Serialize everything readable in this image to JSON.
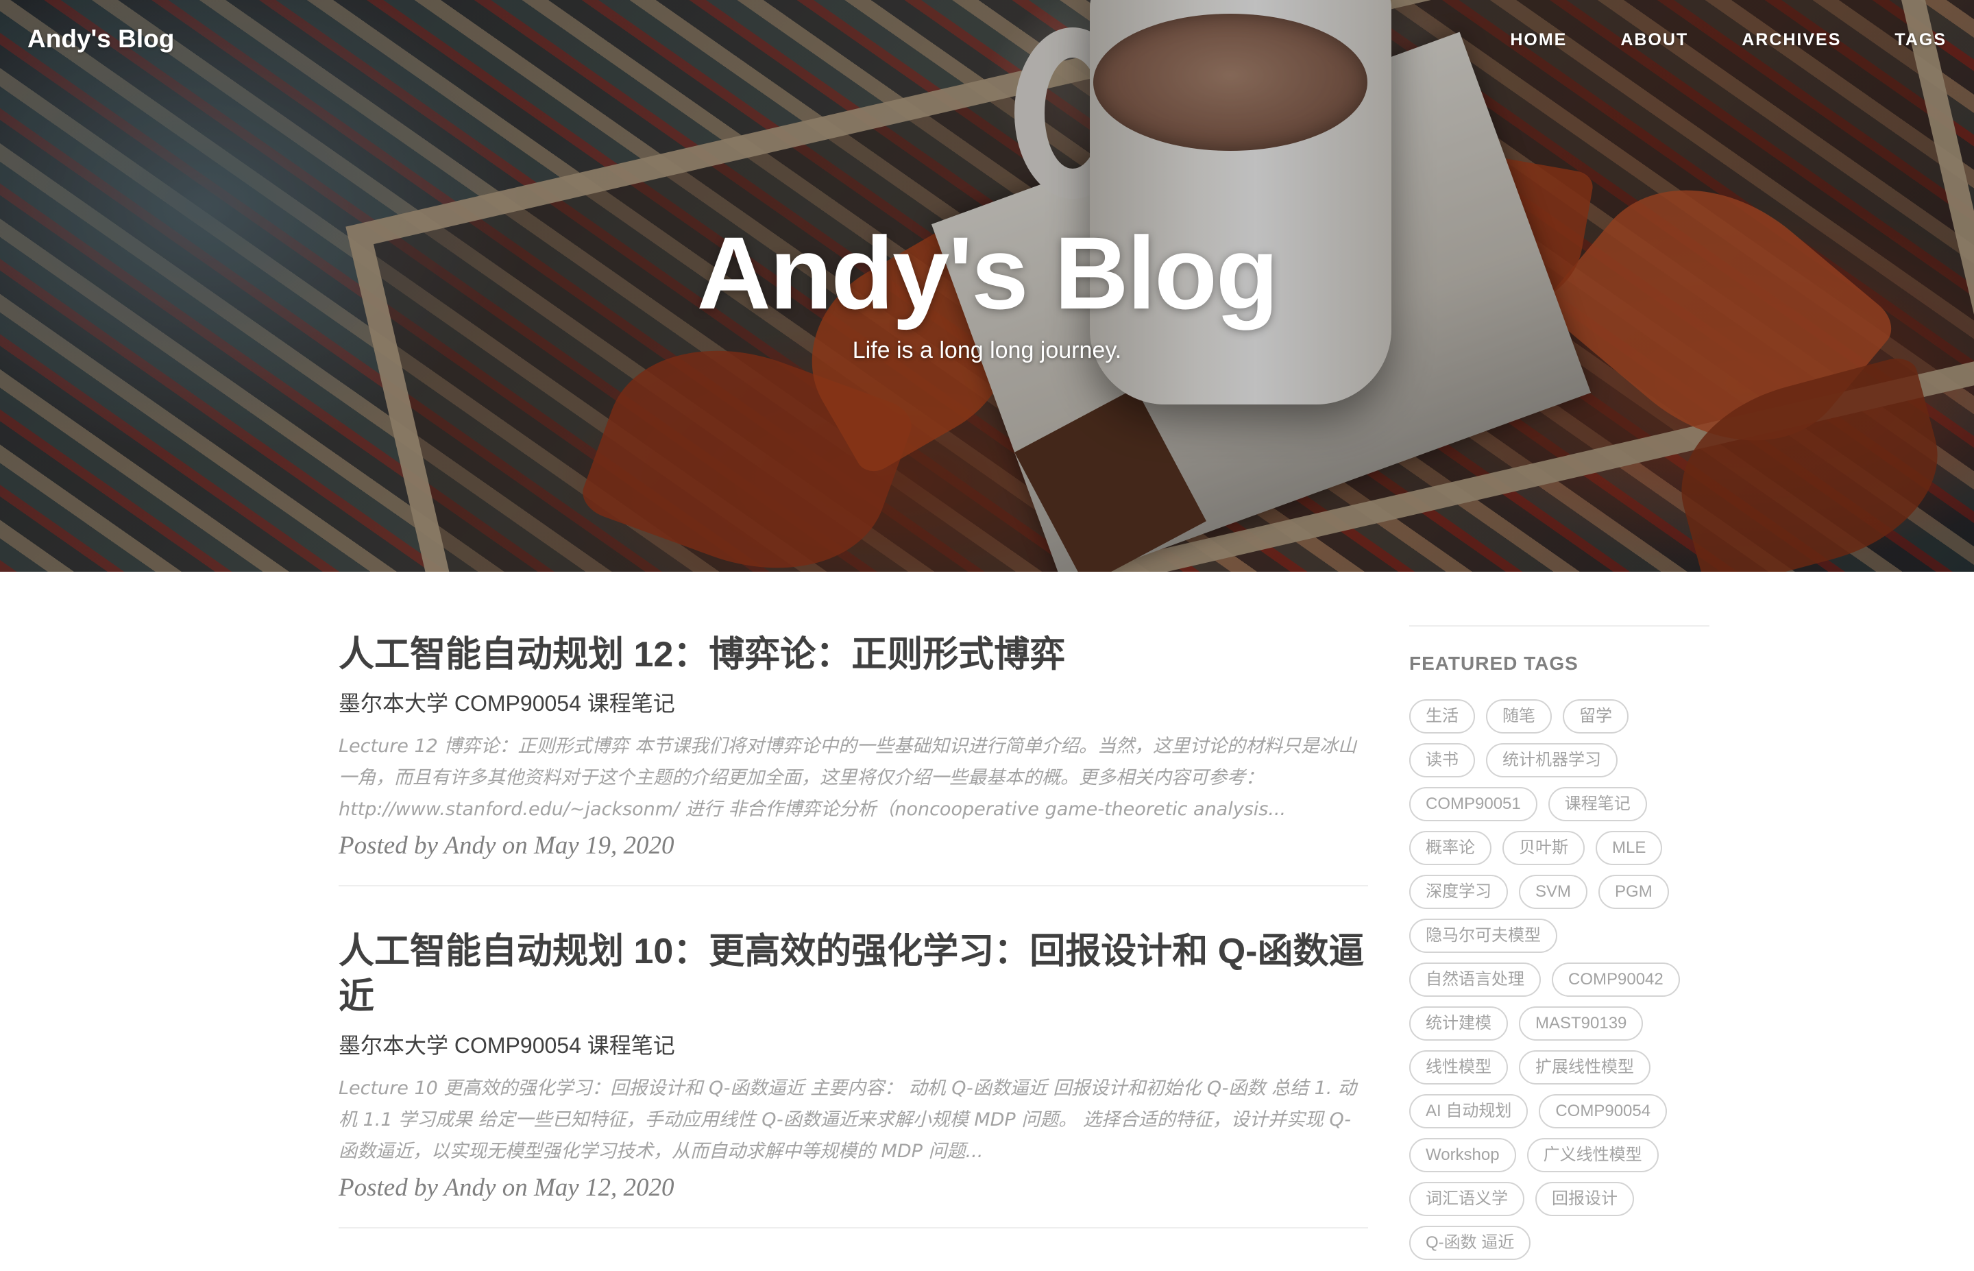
{
  "brand": "Andy's Blog",
  "nav": {
    "items": [
      "HOME",
      "ABOUT",
      "ARCHIVES",
      "TAGS"
    ]
  },
  "hero": {
    "title": "Andy's Blog",
    "subtitle": "Life is a long long journey."
  },
  "posts": [
    {
      "title": "人工智能自动规划 12：博弈论：正则形式博弈",
      "subtitle": "墨尔本大学 COMP90054 课程笔记",
      "excerpt": "Lecture 12 博弈论：正则形式博弈 本节课我们将对博弈论中的一些基础知识进行简单介绍。当然，这里讨论的材料只是冰山一角，而且有许多其他资料对于这个主题的介绍更加全面，这里将仅介绍一些最基本的概。更多相关内容可参考：http://www.stanford.edu/~jacksonm/ 进行 非合作博弈论分析（noncooperative game-theoretic analysis...",
      "meta": "Posted by Andy on May 19, 2020"
    },
    {
      "title": "人工智能自动规划 10：更高效的强化学习：回报设计和 Q-函数逼近",
      "subtitle": "墨尔本大学 COMP90054 课程笔记",
      "excerpt": "Lecture 10 更高效的强化学习：回报设计和 Q-函数逼近 主要内容： 动机 Q-函数逼近 回报设计和初始化 Q-函数 总结 1. 动机 1.1 学习成果 给定一些已知特征，手动应用线性 Q-函数逼近来求解小规模 MDP 问题。 选择合适的特征，设计并实现 Q-函数逼近，以实现无模型强化学习技术，从而自动求解中等规模的 MDP 问题...",
      "meta": "Posted by Andy on May 12, 2020"
    }
  ],
  "sidebar": {
    "heading": "FEATURED TAGS",
    "tags": [
      "生活",
      "随笔",
      "留学",
      "读书",
      "统计机器学习",
      "COMP90051",
      "课程笔记",
      "概率论",
      "贝叶斯",
      "MLE",
      "深度学习",
      "SVM",
      "PGM",
      "隐马尔可夫模型",
      "自然语言处理",
      "COMP90042",
      "统计建模",
      "MAST90139",
      "线性模型",
      "扩展线性模型",
      "AI 自动规划",
      "COMP90054",
      "Workshop",
      "广义线性模型",
      "词汇语义学",
      "回报设计",
      "Q-函数 逼近"
    ]
  },
  "colors": {
    "text": "#404040",
    "muted": "#a3a3a3",
    "meta": "#808080",
    "tag_border": "#d3d3d3"
  }
}
